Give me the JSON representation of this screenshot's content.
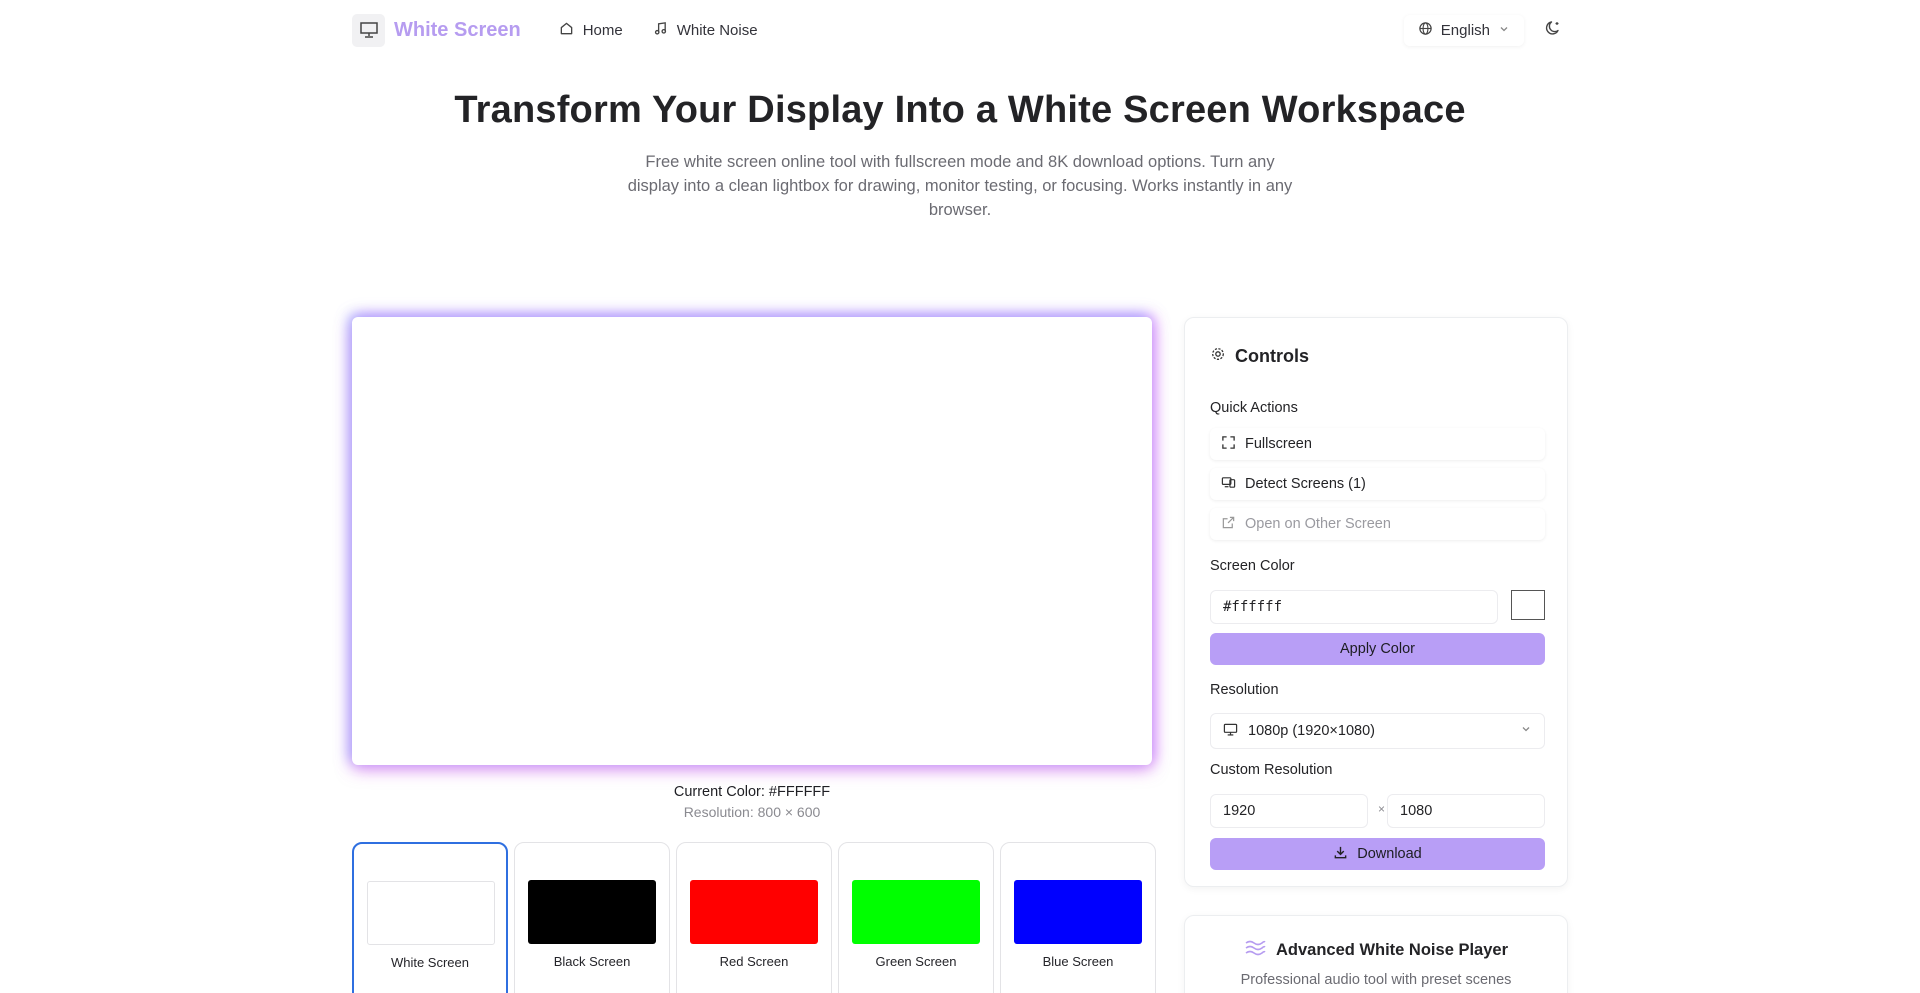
{
  "nav": {
    "brand": "White Screen",
    "logo_icon": "monitor-logo-icon",
    "links": [
      {
        "label": "Home",
        "icon": "home-icon"
      },
      {
        "label": "White Noise",
        "icon": "music-note-icon"
      }
    ],
    "language": "English",
    "theme_icon": "moon-icon"
  },
  "hero": {
    "title": "Transform Your Display Into a White Screen Workspace",
    "subtitle": "Free white screen online tool with fullscreen mode and 8K download options. Turn any display into a clean lightbox for drawing, monitor testing, or focusing. Works instantly in any browser."
  },
  "preview": {
    "color": "#ffffff",
    "current_color": "Current Color: #FFFFFF",
    "resolution": "Resolution: 800 × 600"
  },
  "presets": [
    {
      "label": "White Screen",
      "color": "#ffffff",
      "active": true
    },
    {
      "label": "Black Screen",
      "color": "#000000",
      "active": false
    },
    {
      "label": "Red Screen",
      "color": "#ff0000",
      "active": false
    },
    {
      "label": "Green Screen",
      "color": "#00ff00",
      "active": false
    },
    {
      "label": "Blue Screen",
      "color": "#0000ff",
      "active": false
    }
  ],
  "controls": {
    "title": "Controls",
    "quick_actions_label": "Quick Actions",
    "fullscreen": "Fullscreen",
    "detect_screens": "Detect Screens (1)",
    "open_other": "Open on Other Screen",
    "screen_color_label": "Screen Color",
    "color_value": "#ffffff",
    "apply_color": "Apply Color",
    "resolution_label": "Resolution",
    "resolution_value": "1080p (1920×1080)",
    "custom_resolution_label": "Custom Resolution",
    "width": "1920",
    "height": "1080",
    "times": "×",
    "download": "Download"
  },
  "noise": {
    "title": "Advanced White Noise Player",
    "subtitle": "Professional audio tool with preset scenes"
  },
  "colors": {
    "brand": "#b69cf0",
    "button": "#b89ef6",
    "active_border": "#2f6fe0"
  }
}
